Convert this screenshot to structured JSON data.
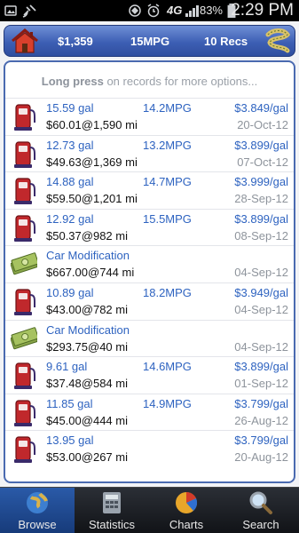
{
  "status_bar": {
    "network": "4G",
    "battery": "83%",
    "time": "2:29 PM"
  },
  "summary": {
    "total_cost": "$1,359",
    "avg_mpg": "15MPG",
    "records": "10 Recs"
  },
  "hint": {
    "bold": "Long press",
    "rest": " on records for more options..."
  },
  "records": [
    {
      "type": "fuel",
      "gallons": "15.59 gal",
      "mpg": "14.2MPG",
      "price": "$3.849/gal",
      "cost": "$60.01",
      "odometer": "1,590 mi",
      "date": "20-Oct-12"
    },
    {
      "type": "fuel",
      "gallons": "12.73 gal",
      "mpg": "13.2MPG",
      "price": "$3.899/gal",
      "cost": "$49.63",
      "odometer": "1,369 mi",
      "date": "07-Oct-12"
    },
    {
      "type": "fuel",
      "gallons": "14.88 gal",
      "mpg": "14.7MPG",
      "price": "$3.999/gal",
      "cost": "$59.50",
      "odometer": "1,201 mi",
      "date": "28-Sep-12"
    },
    {
      "type": "fuel",
      "gallons": "12.92 gal",
      "mpg": "15.5MPG",
      "price": "$3.899/gal",
      "cost": "$50.37",
      "odometer": "982 mi",
      "date": "08-Sep-12"
    },
    {
      "type": "expense",
      "label": "Car Modification",
      "cost": "$667.00",
      "odometer": "744 mi",
      "date": "04-Sep-12"
    },
    {
      "type": "fuel",
      "gallons": "10.89 gal",
      "mpg": "18.2MPG",
      "price": "$3.949/gal",
      "cost": "$43.00",
      "odometer": "782 mi",
      "date": "04-Sep-12"
    },
    {
      "type": "expense",
      "label": "Car Modification",
      "cost": "$293.75",
      "odometer": "40 mi",
      "date": "04-Sep-12"
    },
    {
      "type": "fuel",
      "gallons": "9.61 gal",
      "mpg": "14.6MPG",
      "price": "$3.899/gal",
      "cost": "$37.48",
      "odometer": "584 mi",
      "date": "01-Sep-12"
    },
    {
      "type": "fuel",
      "gallons": "11.85 gal",
      "mpg": "14.9MPG",
      "price": "$3.799/gal",
      "cost": "$45.00",
      "odometer": "444 mi",
      "date": "26-Aug-12"
    },
    {
      "type": "fuel",
      "gallons": "13.95 gal",
      "mpg": "",
      "price": "$3.799/gal",
      "cost": "$53.00",
      "odometer": "267 mi",
      "date": "20-Aug-12"
    }
  ],
  "tabs": [
    {
      "label": "Browse",
      "icon": "globe-icon",
      "active": true
    },
    {
      "label": "Statistics",
      "icon": "calculator-icon",
      "active": false
    },
    {
      "label": "Charts",
      "icon": "pie-chart-icon",
      "active": false
    },
    {
      "label": "Search",
      "icon": "magnifier-icon",
      "active": false
    }
  ],
  "colors": {
    "accent_blue": "#2e63c0",
    "summary_bar": "#3d5fb4",
    "fuel_pump": "#c0282c"
  }
}
